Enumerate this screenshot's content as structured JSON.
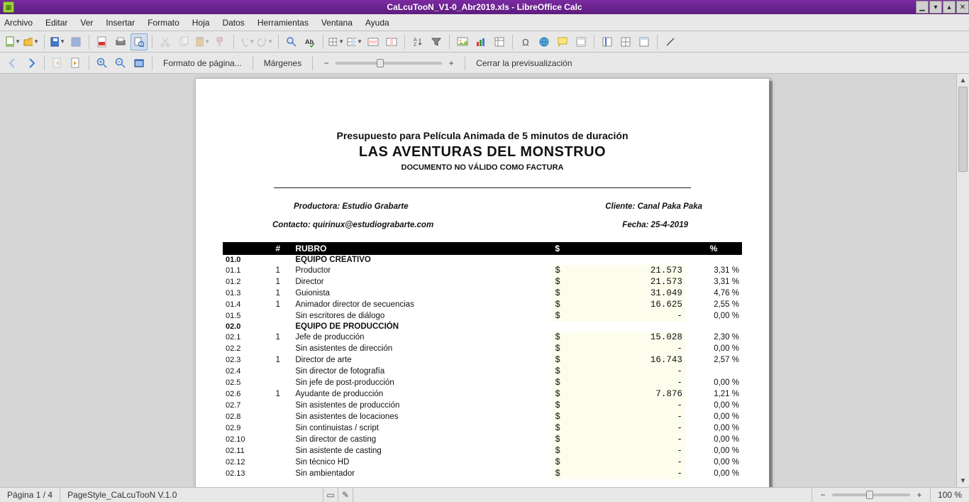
{
  "window": {
    "title": "CaLcuTooN_V1-0_Abr2019.xls - LibreOffice Calc"
  },
  "menu": [
    "Archivo",
    "Editar",
    "Ver",
    "Insertar",
    "Formato",
    "Hoja",
    "Datos",
    "Herramientas",
    "Ventana",
    "Ayuda"
  ],
  "preview_toolbar": {
    "format": "Formato de página...",
    "margins": "Márgenes",
    "close": "Cerrar la previsualización"
  },
  "document": {
    "title1": "Presupuesto para Película Animada de 5 minutos de duración",
    "title2": "LAS AVENTURAS DEL MONSTRUO",
    "title3": "DOCUMENTO NO VÁLIDO COMO FACTURA",
    "producer_label": "Productora: Estudio Grabarte",
    "client_label": "Cliente: Canal Paka Paka",
    "contact_label": "Contacto: quirinux@estudiograbarte.com",
    "date_label": "Fecha: 25-4-2019"
  },
  "table_header": {
    "id": "#",
    "rubro": "RUBRO",
    "amount": "$",
    "pct": "%"
  },
  "rows": [
    {
      "type": "group",
      "id": "01.0",
      "name": "EQUIPO CREATIVO"
    },
    {
      "type": "item",
      "id": "01.1",
      "qty": "1",
      "name": "Productor",
      "amount": "21.573",
      "pct": "3,31 %"
    },
    {
      "type": "item",
      "id": "01.2",
      "qty": "1",
      "name": "Director",
      "amount": "21.573",
      "pct": "3,31 %"
    },
    {
      "type": "item",
      "id": "01.3",
      "qty": "1",
      "name": "Guionista",
      "amount": "31.049",
      "pct": "4,76 %"
    },
    {
      "type": "item",
      "id": "01.4",
      "qty": "1",
      "name": "Animador director de secuencias",
      "amount": "16.625",
      "pct": "2,55 %"
    },
    {
      "type": "item",
      "id": "01.5",
      "qty": "",
      "name": "Sin escritores de diálogo",
      "amount": "-",
      "pct": "0,00 %"
    },
    {
      "type": "group",
      "id": "02.0",
      "name": "EQUIPO DE PRODUCCIÓN"
    },
    {
      "type": "item",
      "id": "02.1",
      "qty": "1",
      "name": "Jefe de producción",
      "amount": "15.028",
      "pct": "2,30 %"
    },
    {
      "type": "item",
      "id": "02.2",
      "qty": "",
      "name": "Sin asistentes de dirección",
      "amount": "-",
      "pct": "0,00 %"
    },
    {
      "type": "item",
      "id": "02.3",
      "qty": "1",
      "name": "Director de arte",
      "amount": "16.743",
      "pct": "2,57 %"
    },
    {
      "type": "item",
      "id": "02.4",
      "qty": "",
      "name": "Sin director de fotografía",
      "amount": "-",
      "pct": ""
    },
    {
      "type": "item",
      "id": "02.5",
      "qty": "",
      "name": "Sin jefe de post-producción",
      "amount": "-",
      "pct": "0,00 %"
    },
    {
      "type": "item",
      "id": "02.6",
      "qty": "1",
      "name": "Ayudante de producción",
      "amount": "7.876",
      "pct": "1,21 %"
    },
    {
      "type": "item",
      "id": "02.7",
      "qty": "",
      "name": "Sin asistentes de producción",
      "amount": "-",
      "pct": "0,00 %"
    },
    {
      "type": "item",
      "id": "02.8",
      "qty": "",
      "name": "Sin asistentes de locaciones",
      "amount": "-",
      "pct": "0,00 %"
    },
    {
      "type": "item",
      "id": "02.9",
      "qty": "",
      "name": "Sin continuistas / script",
      "amount": "-",
      "pct": "0,00 %"
    },
    {
      "type": "item",
      "id": "02.10",
      "qty": "",
      "name": "Sin director de casting",
      "amount": "-",
      "pct": "0,00 %"
    },
    {
      "type": "item",
      "id": "02.11",
      "qty": "",
      "name": "Sin asistente de casting",
      "amount": "-",
      "pct": "0,00 %"
    },
    {
      "type": "item",
      "id": "02.12",
      "qty": "",
      "name": "Sin técnico HD",
      "amount": "-",
      "pct": "0,00 %"
    },
    {
      "type": "item",
      "id": "02.13",
      "qty": "",
      "name": "Sin ambientador",
      "amount": "-",
      "pct": "0,00 %"
    }
  ],
  "status": {
    "page": "Página 1 / 4",
    "style": "PageStyle_CaLcuTooN V.1.0",
    "zoom": "100 %"
  }
}
